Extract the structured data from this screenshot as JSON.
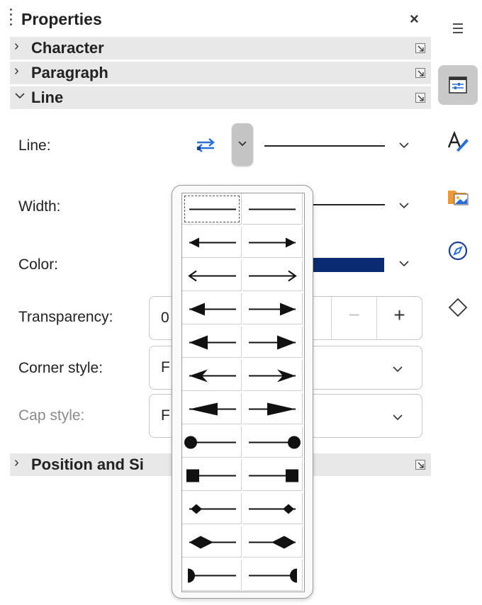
{
  "panel": {
    "title": "Properties",
    "close_glyph": "×"
  },
  "sections": {
    "character": {
      "label": "Character",
      "expanded": false
    },
    "paragraph": {
      "label": "Paragraph",
      "expanded": false
    },
    "line": {
      "label": "Line",
      "expanded": true
    },
    "position_size": {
      "label": "Position and Si",
      "expanded": false
    }
  },
  "line_section": {
    "line_label": "Line:",
    "width_label": "Width:",
    "color_label": "Color:",
    "color_value": "#0a2a72",
    "transparency_label": "Transparency:",
    "transparency_value": "0",
    "minus_glyph": "−",
    "plus_glyph": "+",
    "corner_label": "Corner style:",
    "corner_value": "F",
    "cap_label": "Cap style:",
    "cap_value": "F"
  },
  "arrow_popup": {
    "rows": [
      {
        "left": "none",
        "right": "none",
        "selected_left": true
      },
      {
        "left": "arrow",
        "right": "arrow"
      },
      {
        "left": "open-arrow",
        "right": "open-arrow"
      },
      {
        "left": "wide-arrow",
        "right": "wide-arrow"
      },
      {
        "left": "large-arrow",
        "right": "large-arrow"
      },
      {
        "left": "concave-arrow",
        "right": "concave-arrow"
      },
      {
        "left": "flat-arrow",
        "right": "flat-arrow"
      },
      {
        "left": "circle",
        "right": "circle"
      },
      {
        "left": "square",
        "right": "square"
      },
      {
        "left": "diamond-small",
        "right": "diamond-small"
      },
      {
        "left": "diamond-large",
        "right": "diamond-large"
      },
      {
        "left": "half-circle",
        "right": "half-circle"
      }
    ]
  },
  "sidebar": {
    "items": [
      {
        "name": "menu-icon",
        "active": false
      },
      {
        "name": "properties-icon",
        "active": true
      },
      {
        "name": "styles-icon",
        "active": false
      },
      {
        "name": "gallery-icon",
        "active": false
      },
      {
        "name": "navigator-icon",
        "active": false
      },
      {
        "name": "shapes-icon",
        "active": false
      }
    ]
  },
  "colors": {
    "section_bg": "#e8e8e8",
    "active_bg": "#c9c9c9",
    "accent_blue": "#2a6fd4"
  }
}
